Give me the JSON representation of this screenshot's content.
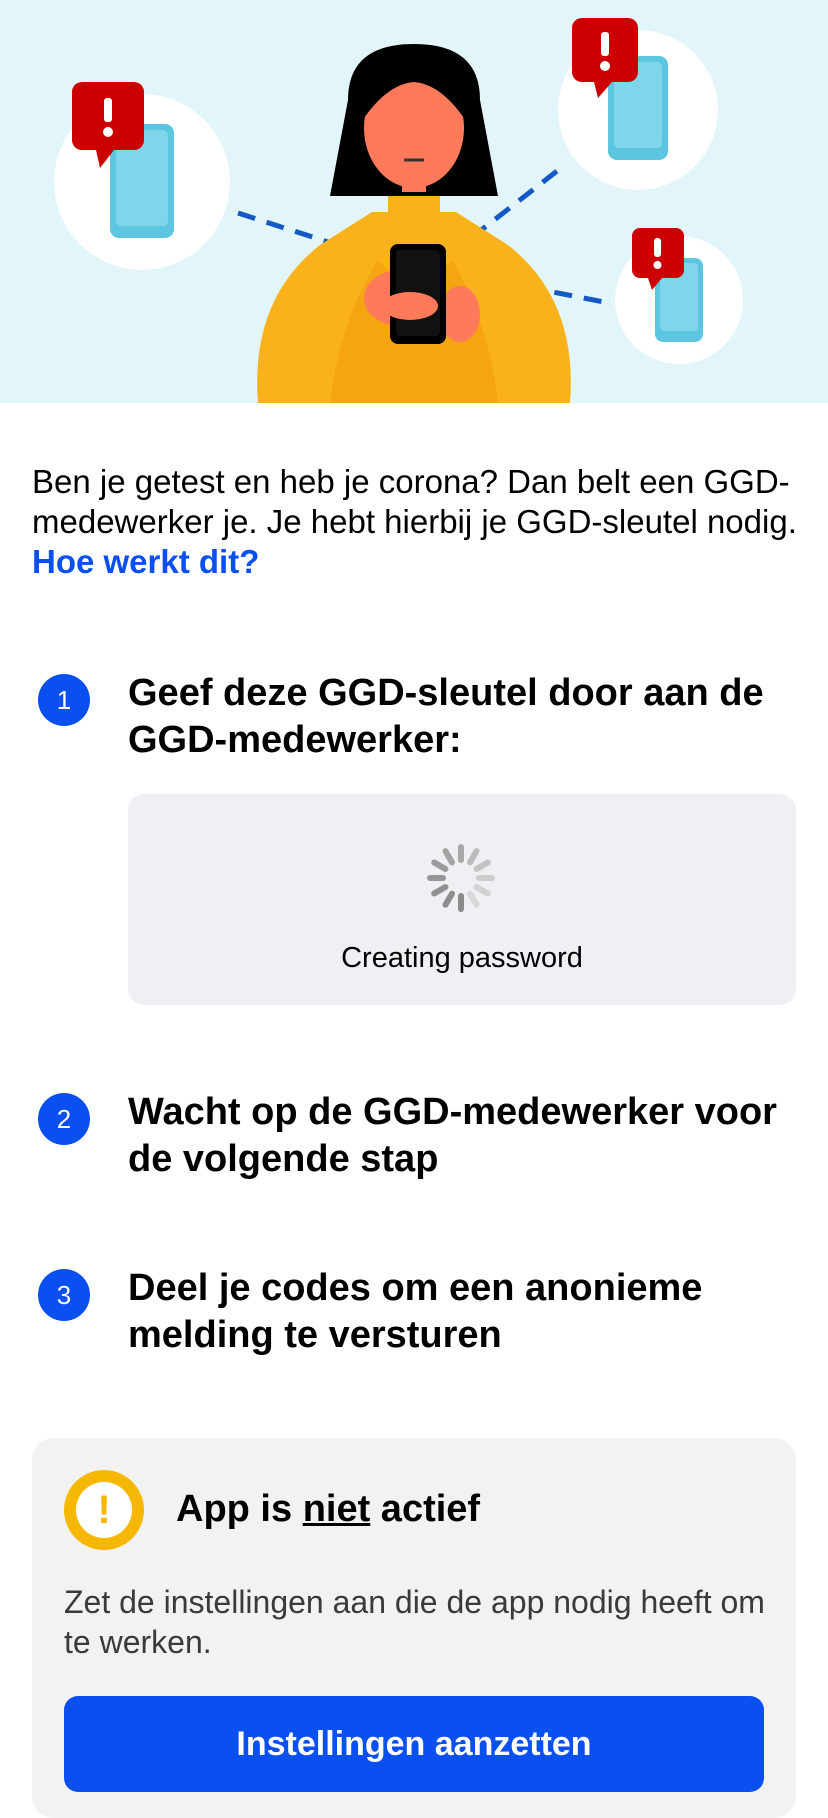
{
  "intro": {
    "text": "Ben je getest en heb je corona? Dan belt een GGD-medewerker je. Je hebt hierbij je GGD-sleutel nodig. ",
    "link": "Hoe werkt dit?"
  },
  "steps": [
    {
      "number": "1",
      "title": "Geef deze GGD-sleutel door aan de GGD-medewerker:"
    },
    {
      "number": "2",
      "title": "Wacht op de GGD-medewerker voor de volgende stap"
    },
    {
      "number": "3",
      "title": "Deel je codes om een anonieme melding te versturen"
    }
  ],
  "key_box": {
    "status": "Creating password",
    "spinner_icon": "loading-spinner-icon"
  },
  "status_card": {
    "icon": "warning-icon",
    "icon_glyph": "!",
    "title_pre": "App is ",
    "title_emph": "niet",
    "title_post": " actief",
    "body": "Zet de instellingen aan die de app nodig heeft om te werken.",
    "button": "Instellingen aanzetten"
  },
  "colors": {
    "accent": "#0a4ff0",
    "warning": "#f5b700",
    "hero_bg": "#e2f5f8",
    "alert_red": "#cc0000"
  }
}
